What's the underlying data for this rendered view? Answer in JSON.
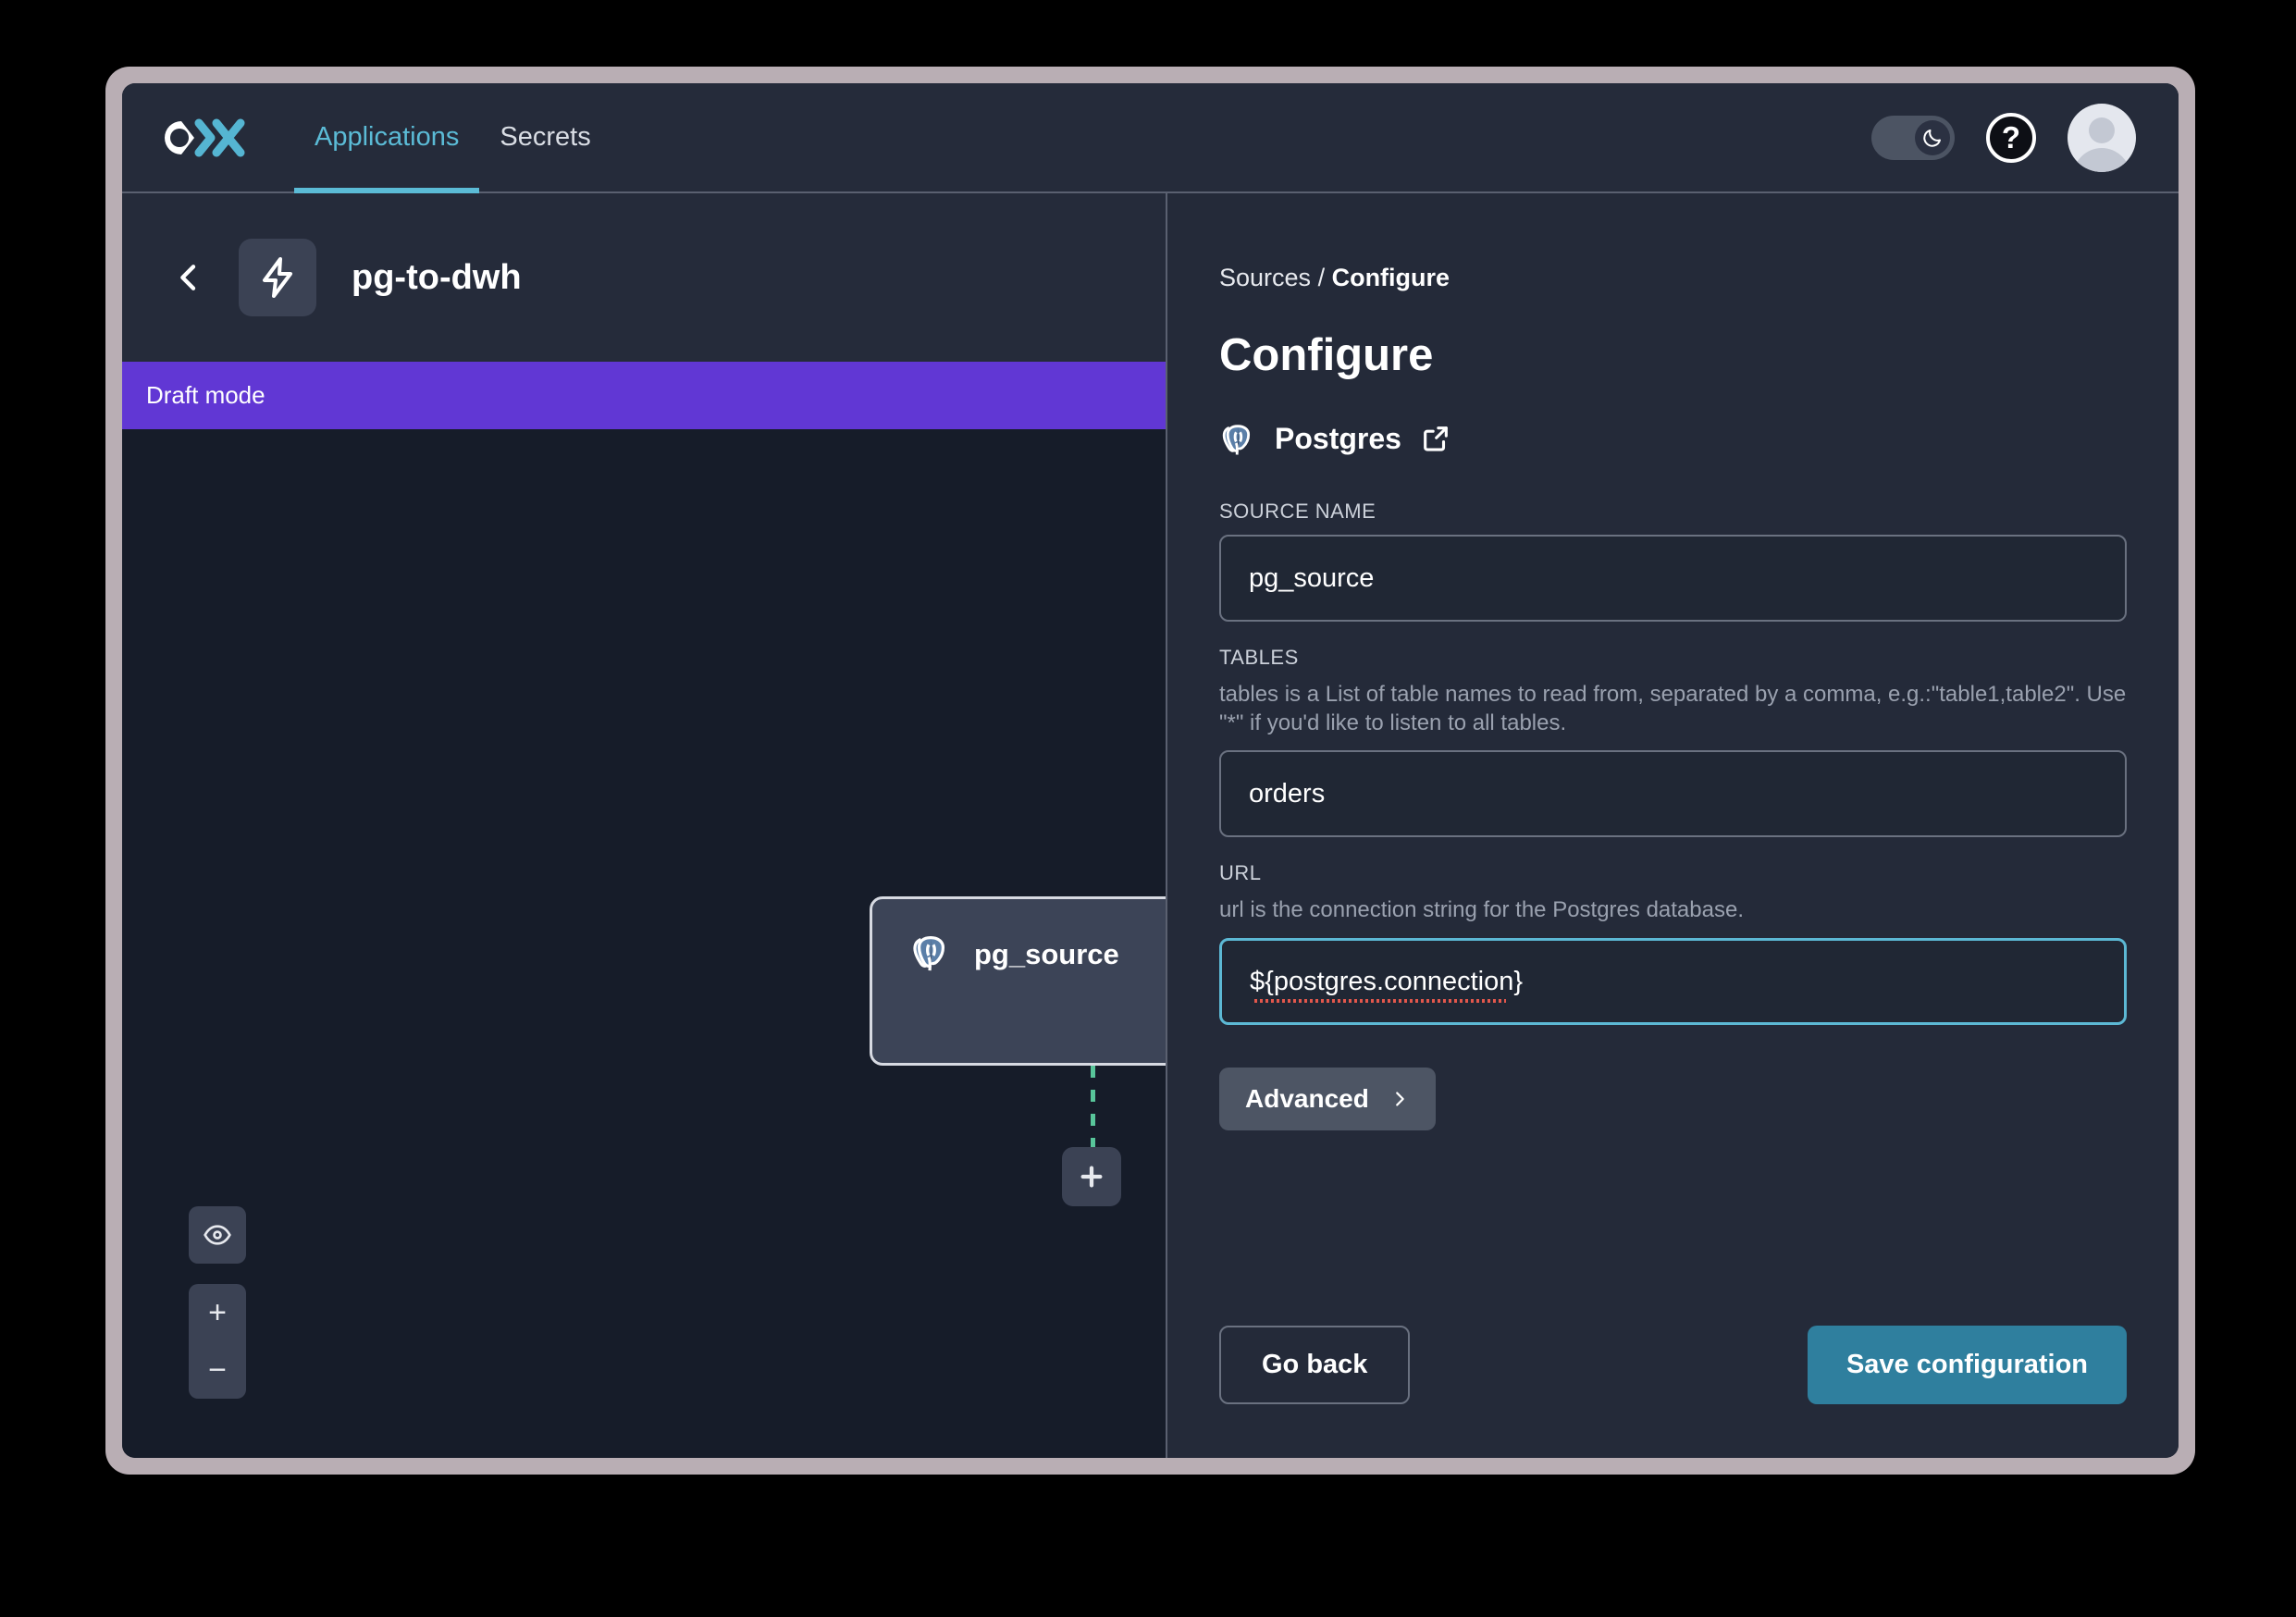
{
  "header": {
    "logo_alt": "oxla-logo",
    "tabs": [
      {
        "label": "Applications",
        "active": true
      },
      {
        "label": "Secrets",
        "active": false
      }
    ],
    "theme_toggle_icon": "moon-icon",
    "help_icon": "question-mark-icon",
    "help_glyph": "?",
    "avatar_alt": "user-avatar"
  },
  "flow": {
    "back_icon": "chevron-left-icon",
    "app_icon": "lightning-bolt-icon",
    "title": "pg-to-dwh",
    "status_banner": "Draft mode",
    "node": {
      "icon": "postgres-elephant-icon",
      "label": "pg_source"
    },
    "add_node_icon": "plus-icon",
    "controls": {
      "fit_view_icon": "eye-icon",
      "zoom_in": "+",
      "zoom_out": "−"
    }
  },
  "panel": {
    "breadcrumb_parent": "Sources",
    "breadcrumb_separator": " / ",
    "breadcrumb_current": "Configure",
    "title": "Configure",
    "connector": {
      "icon": "postgres-elephant-icon",
      "name": "Postgres",
      "external_link_icon": "external-link-icon"
    },
    "fields": [
      {
        "label": "SOURCE NAME",
        "help": "",
        "value": "pg_source",
        "focused": false
      },
      {
        "label": "TABLES",
        "help": "tables is a List of table names to read from, separated by a comma, e.g.:\"table1,table2\". Use \"*\" if you'd like to listen to all tables.",
        "value": "orders",
        "focused": false
      },
      {
        "label": "URL",
        "help": "url is the connection string for the Postgres database.",
        "value": "${postgres.connection}",
        "focused": true
      }
    ],
    "advanced_label": "Advanced",
    "advanced_icon": "chevron-right-icon",
    "go_back_label": "Go back",
    "save_label": "Save configuration"
  },
  "colors": {
    "accent": "#5bbbd6",
    "primary_button": "#2f7f9e",
    "draft_banner": "#6137d4",
    "edge": "#58c59a",
    "window_border": "#b9aeb4",
    "canvas_bg": "#161c29",
    "panel_bg": "#242a39"
  }
}
